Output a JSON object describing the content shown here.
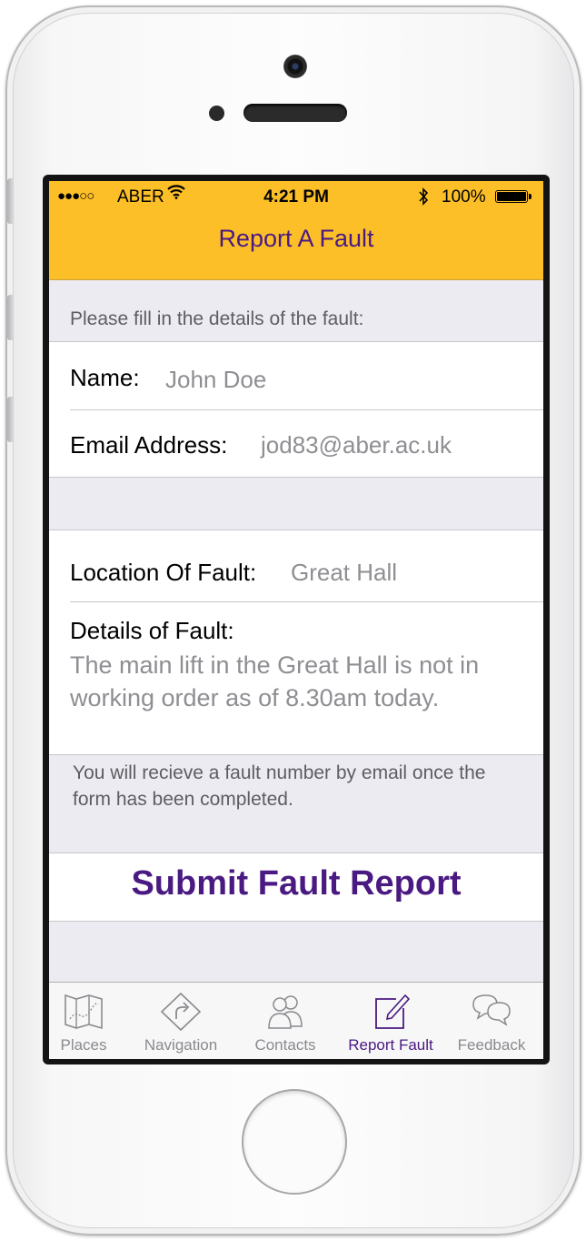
{
  "status": {
    "signal": "●●●○○",
    "carrier": "ABER",
    "time": "4:21 PM",
    "battery_pct": "100%",
    "battery_level": 1.0
  },
  "nav": {
    "title": "Report A Fault"
  },
  "form": {
    "hint": "Please fill in the details of the fault:",
    "name_label": "Name:",
    "name_value": "John Doe",
    "email_label": "Email Address:",
    "email_value": "jod83@aber.ac.uk",
    "location_label": "Location Of Fault:",
    "location_value": "Great Hall",
    "details_label": "Details of Fault:",
    "details_value": "The main lift in the Great Hall is not in working order as of 8.30am today.",
    "footer_note": "You will recieve a fault number by email once the form has been completed.",
    "submit_label": "Submit Fault Report"
  },
  "tabs": [
    {
      "label": "Places",
      "icon": "map-icon"
    },
    {
      "label": "Navigation",
      "icon": "navigation-sign-icon"
    },
    {
      "label": "Contacts",
      "icon": "contacts-icon"
    },
    {
      "label": "Report Fault",
      "icon": "compose-icon",
      "active": true
    },
    {
      "label": "Feedback",
      "icon": "chat-bubbles-icon"
    }
  ],
  "colors": {
    "accent": "#4a1a82",
    "navbar": "#fcbf28",
    "background": "#ebebf1"
  }
}
